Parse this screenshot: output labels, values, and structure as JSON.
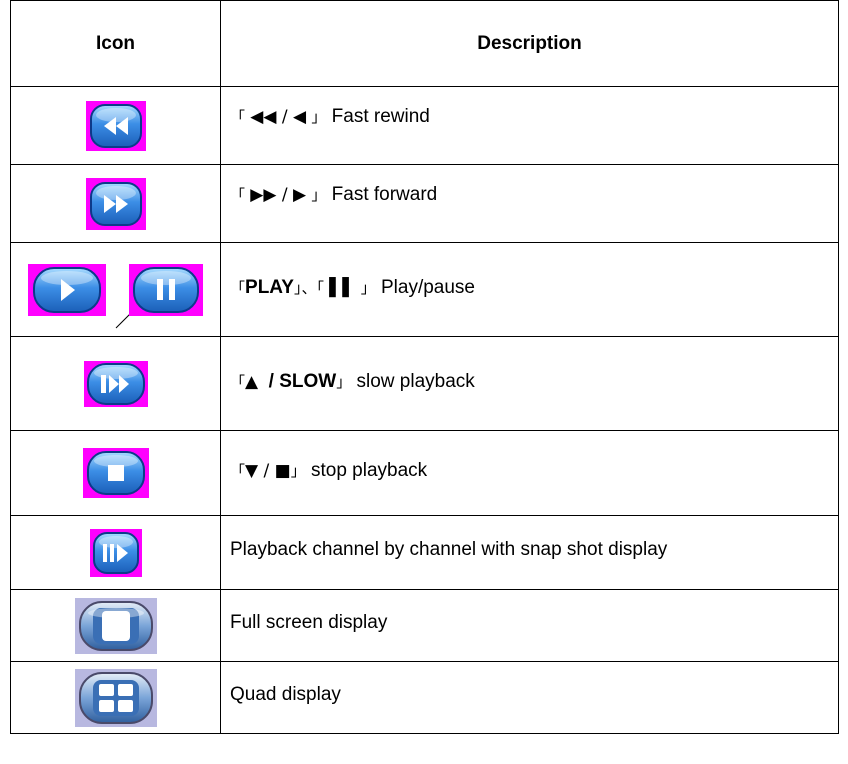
{
  "table": {
    "header_icon": "Icon",
    "header_description": "Description",
    "rows": [
      {
        "icon": "fast-rewind-icon",
        "description": {
          "open": "「",
          "sym": "◀◀ / ◀",
          "close": "」",
          "text": "Fast rewind"
        }
      },
      {
        "icon": "fast-forward-icon",
        "description": {
          "open": "「",
          "sym": "▶▶  / ▶",
          "close": "」",
          "text": "Fast forward"
        }
      },
      {
        "icon": "play-pause-icon",
        "description": {
          "open": "「",
          "bold1": "PLAY",
          "mid": "」、「",
          "sym": "▌▌",
          "close": "」",
          "text": "Play/pause"
        }
      },
      {
        "icon": "slow-playback-icon",
        "description": {
          "open": "「",
          "sym": "▲",
          "bold1": "/ SLOW",
          "close": "」",
          "text": "slow playback"
        }
      },
      {
        "icon": "stop-icon",
        "description": {
          "open": "「",
          "sym": "▼ / ■",
          "close": "」",
          "text": "stop playback"
        }
      },
      {
        "icon": "channel-playback-icon",
        "description": {
          "text": "Playback channel by channel with snap shot display"
        }
      },
      {
        "icon": "full-screen-icon",
        "description": {
          "text": "Full screen display"
        }
      },
      {
        "icon": "quad-display-icon",
        "description": {
          "text": "Quad display"
        }
      }
    ]
  },
  "colors": {
    "icon_bg_magenta": "#ff00ff",
    "icon_bg_lavender": "#b8b8e0",
    "button_blue": "#2e7cd6",
    "button_border": "#0d3a8a"
  }
}
